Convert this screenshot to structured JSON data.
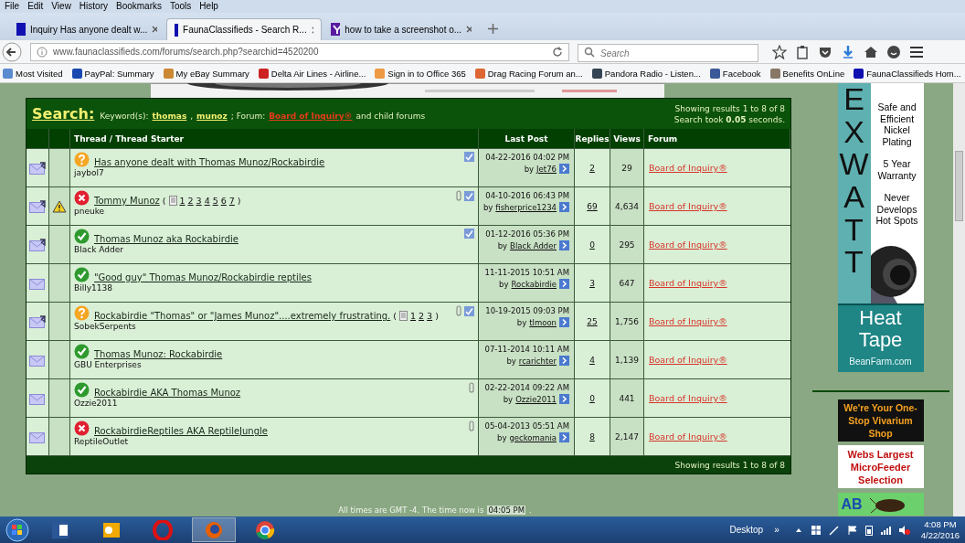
{
  "browser": {
    "menu": [
      "File",
      "Edit",
      "View",
      "History",
      "Bookmarks",
      "Tools",
      "Help"
    ],
    "tabs": [
      {
        "title": "Inquiry Has anyone dealt w...",
        "selected": false,
        "kind": "forum"
      },
      {
        "title": "FaunaClassifieds - Search R...",
        "selected": true,
        "kind": "forum"
      },
      {
        "title": "how to take a screenshot o...",
        "selected": false,
        "kind": "yahoo"
      }
    ],
    "url": "www.faunaclassifieds.com/forums/search.php?searchid=4520200",
    "search_placeholder": "Search",
    "bookmarks": [
      "Most Visited",
      "PayPal: Summary",
      "My eBay Summary",
      "Delta Air Lines - Airline...",
      "Sign in to Office 365",
      "Drag Racing Forum an...",
      "Pandora Radio - Listen...",
      "Facebook",
      "Benefits OnLine",
      "FaunaClassifieds Hom..."
    ]
  },
  "search": {
    "title": "Search:",
    "parts": [
      {
        "text": "Keyword(s):",
        "kind": "label"
      },
      {
        "text": "thomas",
        "kind": "keyword"
      },
      {
        "text": ",",
        "kind": "label"
      },
      {
        "text": "munoz",
        "kind": "keyword"
      },
      {
        "text": "; Forum:",
        "kind": "label"
      },
      {
        "text": "Board of Inquiry®",
        "kind": "forum"
      },
      {
        "text": "and child forums",
        "kind": "label"
      }
    ],
    "results": "Showing results 1 to 8 of 8",
    "took": "Search took **0.05** seconds."
  },
  "columns": [
    "Thread / Thread Starter",
    "Last Post",
    "Replies",
    "Views",
    "Forum"
  ],
  "page_brackets": [
    "(",
    ")"
  ],
  "threads": [
    {
      "posted": true,
      "warning": false,
      "kind": "question",
      "title": "Has anyone dealt with Thomas Munoz/Rockabirdie",
      "starter": "jaybol7",
      "attachment": false,
      "rated": true,
      "date": "04-22-2016 04:02 PM",
      "by": "by",
      "user": "Jet76",
      "replies": "2",
      "views": "29",
      "forum": "Board of Inquiry®"
    },
    {
      "posted": true,
      "warning": true,
      "kind": "rejected",
      "title": "Tommy Munoz",
      "pages": [
        "1",
        "2",
        "3",
        "4",
        "5",
        "6",
        "7"
      ],
      "starter": "pneuke",
      "attachment": true,
      "rated": true,
      "date": "04-10-2016 06:43 PM",
      "by": "by",
      "user": "fisherprice1234",
      "replies": "69",
      "views": "4,634",
      "forum": "Board of Inquiry®"
    },
    {
      "posted": true,
      "warning": false,
      "kind": "approved",
      "title": "Thomas Munoz aka Rockabirdie",
      "starter": "Black Adder",
      "attachment": false,
      "rated": true,
      "date": "01-12-2016 05:36 PM",
      "by": "by",
      "user": "Black Adder",
      "replies": "0",
      "views": "295",
      "forum": "Board of Inquiry®"
    },
    {
      "posted": false,
      "warning": false,
      "kind": "approved",
      "title": "\"Good guy\" Thomas Munoz/Rockabirdie reptiles",
      "starter": "Billy1138",
      "attachment": false,
      "rated": false,
      "date": "11-11-2015 10:51 AM",
      "by": "by",
      "user": "Rockabirdie",
      "replies": "3",
      "views": "647",
      "forum": "Board of Inquiry®"
    },
    {
      "posted": true,
      "warning": false,
      "kind": "question",
      "title": "Rockabirdie \"Thomas\" or \"James Munoz\"....extremely frustrating.",
      "pages": [
        "1",
        "2",
        "3"
      ],
      "starter": "SobekSerpents",
      "attachment": true,
      "rated": true,
      "date": "10-19-2015 09:03 PM",
      "by": "by",
      "user": "tlmoon",
      "replies": "25",
      "views": "1,756",
      "forum": "Board of Inquiry®"
    },
    {
      "posted": false,
      "warning": false,
      "kind": "approved",
      "title": "Thomas Munoz: Rockabirdie",
      "starter": "GBU Enterprises",
      "attachment": false,
      "rated": false,
      "date": "07-11-2014 10:11 AM",
      "by": "by",
      "user": "rcarichter",
      "replies": "4",
      "views": "1,139",
      "forum": "Board of Inquiry®"
    },
    {
      "posted": false,
      "warning": false,
      "kind": "approved",
      "title": "Rockabirdie AKA Thomas Munoz",
      "starter": "Ozzie2011",
      "attachment": true,
      "rated": false,
      "date": "02-22-2014 09:22 AM",
      "by": "by",
      "user": "Ozzie2011",
      "replies": "0",
      "views": "441",
      "forum": "Board of Inquiry®"
    },
    {
      "posted": false,
      "warning": false,
      "kind": "rejected",
      "title": "RockabirdieReptiles AKA ReptileJungle",
      "starter": "ReptileOutlet",
      "attachment": true,
      "rated": false,
      "date": "05-04-2013 05:51 AM",
      "by": "by",
      "user": "geckomania",
      "replies": "8",
      "views": "2,147",
      "forum": "Board of Inquiry®"
    }
  ],
  "footer_results": "Showing results 1 to 8 of 8",
  "time_note": "All times are GMT -4. The time now is",
  "time_now": "04:05 PM",
  "time_end": ".",
  "ads": {
    "brand": "EXWATT",
    "features": [
      "Safe and Efficient Nickel Plating",
      "5 Year Warranty",
      "Never Develops Hot Spots"
    ],
    "product": "Heat Tape",
    "site": "BeanFarm.com",
    "shop": "We're Your One-Stop Vivarium Shop",
    "feeder": "Webs Largest MicroFeeder Selection",
    "ab": "AB"
  },
  "taskbar": {
    "apps": [
      {
        "kind": "word",
        "selected": false
      },
      {
        "kind": "outlook",
        "selected": false
      },
      {
        "kind": "opera",
        "selected": false
      },
      {
        "kind": "firefox",
        "selected": true
      },
      {
        "kind": "chrome",
        "selected": false
      }
    ],
    "desktop": "Desktop",
    "chevron": "»",
    "time": "4:08 PM",
    "date": "4/22/2016"
  }
}
